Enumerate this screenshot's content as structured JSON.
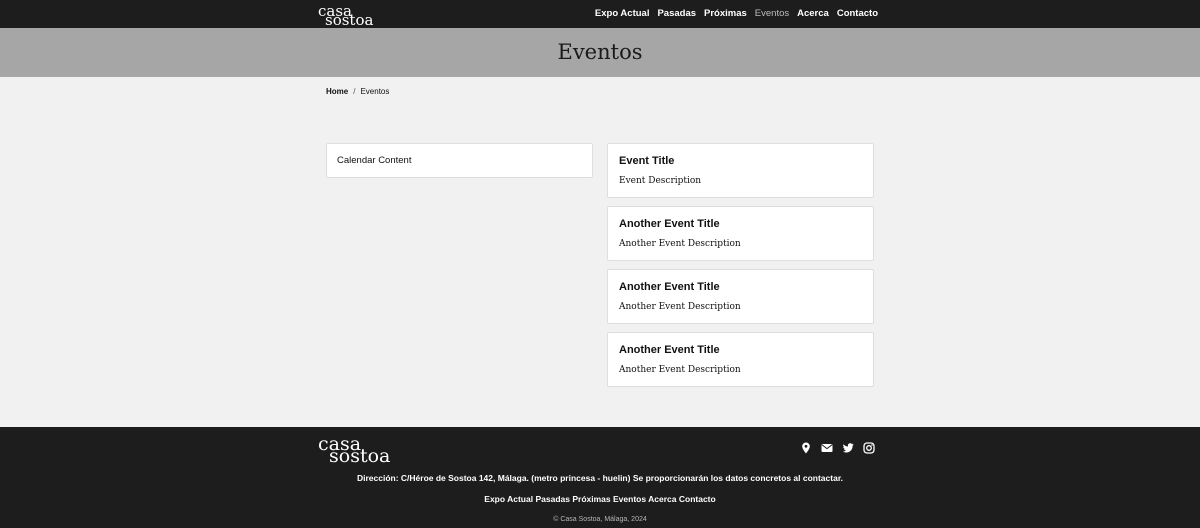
{
  "brand": {
    "line1": "casa",
    "line2": "sostoa"
  },
  "nav": {
    "items": [
      {
        "label": "Expo Actual",
        "active": false
      },
      {
        "label": "Pasadas",
        "active": false
      },
      {
        "label": "Próximas",
        "active": false
      },
      {
        "label": "Eventos",
        "active": true
      },
      {
        "label": "Acerca",
        "active": false
      },
      {
        "label": "Contacto",
        "active": false
      }
    ]
  },
  "hero": {
    "title": "Eventos"
  },
  "breadcrumb": {
    "home": "Home",
    "separator": "/",
    "current": "Eventos"
  },
  "calendar": {
    "label": "Calendar Content"
  },
  "events": [
    {
      "title": "Event Title",
      "description": "Event Description"
    },
    {
      "title": "Another Event Title",
      "description": "Another Event Description"
    },
    {
      "title": "Another Event Title",
      "description": "Another Event Description"
    },
    {
      "title": "Another Event Title",
      "description": "Another Event Description"
    }
  ],
  "footer": {
    "socials": [
      "map-pin-icon",
      "envelope-icon",
      "twitter-icon",
      "instagram-icon"
    ],
    "address": "Dirección: C/Héroe de Sostoa 142, Málaga. (metro princesa - huelin) Se proporcionarán los datos concretos al contactar.",
    "nav": [
      "Expo Actual",
      "Pasadas",
      "Próximas",
      "Eventos",
      "Acerca",
      "Contacto"
    ],
    "copyright": "© Casa Sostoa, Málaga, 2024"
  },
  "colors": {
    "dark": "#1d1d1d",
    "hero": "#a6a6a6",
    "page": "#f1f1f1"
  }
}
